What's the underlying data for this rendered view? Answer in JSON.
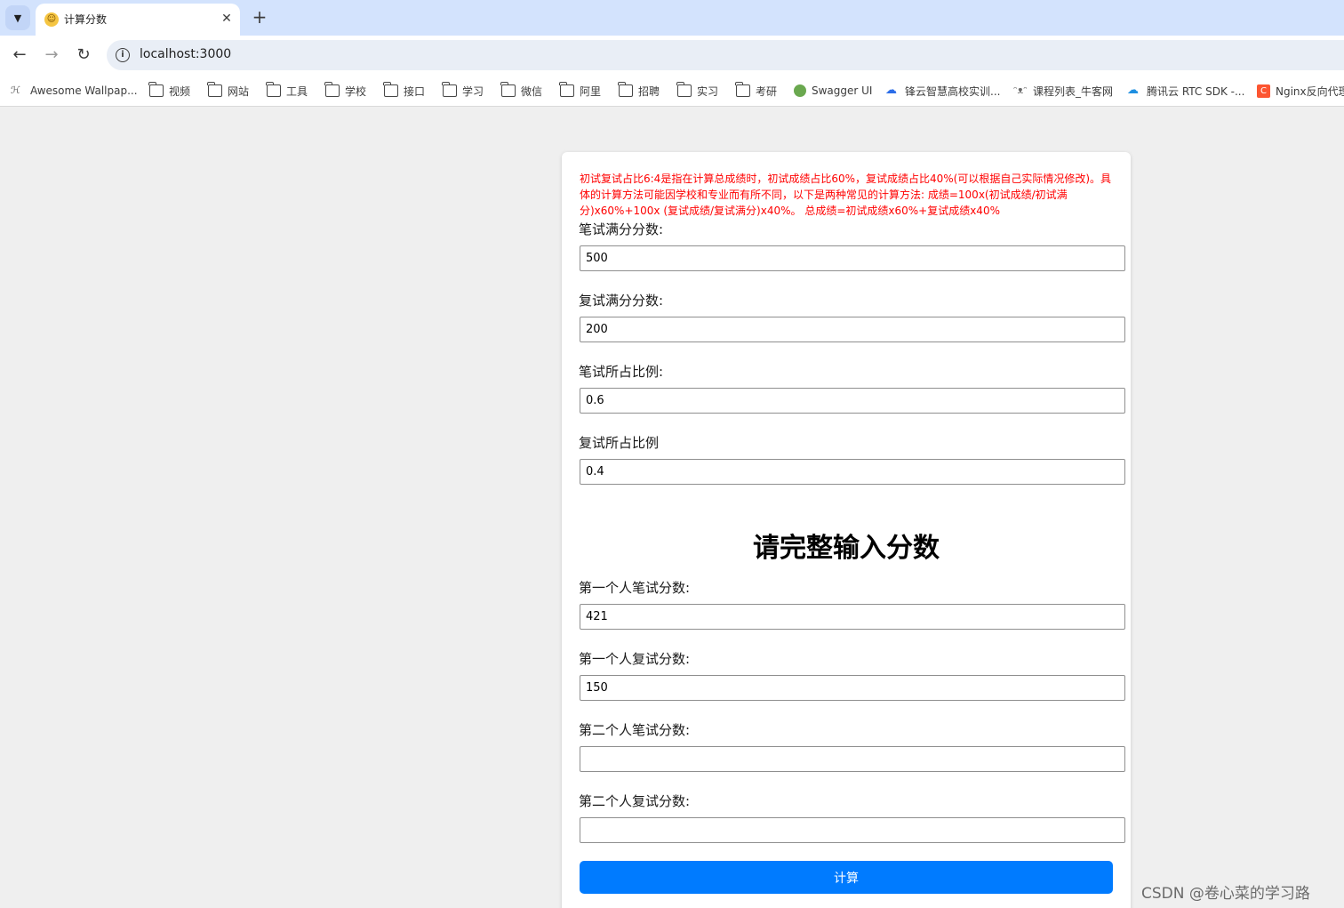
{
  "browser": {
    "tab": {
      "title": "计算分数",
      "favicon": "emoji-face-icon"
    },
    "new_tab_symbol": "+",
    "close_symbol": "✕",
    "url": "localhost:3000",
    "bookmarks": [
      {
        "label": "Awesome Wallpap...",
        "icon": "site-icon"
      },
      {
        "label": "视频",
        "icon": "folder-icon"
      },
      {
        "label": "网站",
        "icon": "folder-icon"
      },
      {
        "label": "工具",
        "icon": "folder-icon"
      },
      {
        "label": "学校",
        "icon": "folder-icon"
      },
      {
        "label": "接口",
        "icon": "folder-icon"
      },
      {
        "label": "学习",
        "icon": "folder-icon"
      },
      {
        "label": "微信",
        "icon": "folder-icon"
      },
      {
        "label": "阿里",
        "icon": "folder-icon"
      },
      {
        "label": "招聘",
        "icon": "folder-icon"
      },
      {
        "label": "实习",
        "icon": "folder-icon"
      },
      {
        "label": "考研",
        "icon": "folder-icon"
      },
      {
        "label": "Swagger UI",
        "icon": "swagger-icon"
      },
      {
        "label": "锋云智慧高校实训...",
        "icon": "cloud-icon"
      },
      {
        "label": "课程列表_牛客网",
        "icon": "nowcoder-icon"
      },
      {
        "label": "腾讯云 RTC SDK -...",
        "icon": "tencent-cloud-icon"
      },
      {
        "label": "Nginx反向代理",
        "icon": "csdn-icon"
      }
    ]
  },
  "form": {
    "note": "初试复试占比6:4是指在计算总成绩时，初试成绩占比60%，复试成绩占比40%(可以根据自己实际情况修改)。具体的计算方法可能因学校和专业而有所不同，以下是两种常见的计算方法: 成绩=100x(初试成绩/初试满分)x60%+100x (复试成绩/复试满分)x40%。 总成绩=初试成绩x60%+复试成绩x40%",
    "written_full_label": "笔试满分分数:",
    "written_full_value": "500",
    "retest_full_label": "复试满分分数:",
    "retest_full_value": "200",
    "written_ratio_label": "笔试所占比例:",
    "written_ratio_value": "0.6",
    "retest_ratio_label": "复试所占比例",
    "retest_ratio_value": "0.4",
    "heading": "请完整输入分数",
    "p1_written_label": "第一个人笔试分数:",
    "p1_written_value": "421",
    "p1_retest_label": "第一个人复试分数:",
    "p1_retest_value": "150",
    "p2_written_label": "第二个人笔试分数:",
    "p2_written_value": "",
    "p2_retest_label": "第二个人复试分数:",
    "p2_retest_value": "",
    "button_label": "计算"
  },
  "watermark": "CSDN @卷心菜的学习路",
  "colors": {
    "note": "#ff0000",
    "button": "#007bff",
    "tabstrip": "#d3e3fd",
    "page_bg": "#efefef"
  }
}
